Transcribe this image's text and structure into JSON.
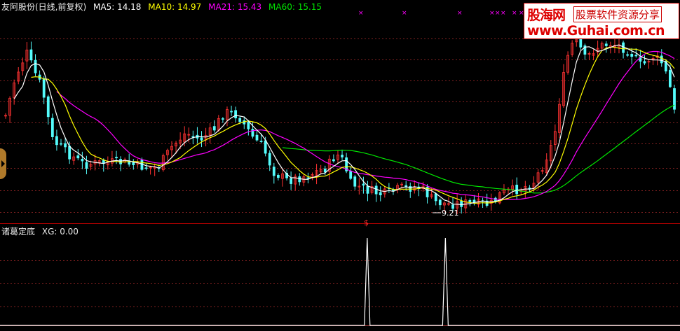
{
  "header": {
    "stock": "友阿股份(日线,前复权)",
    "ma5": "MA5: 14.18",
    "ma10": "MA10: 14.97",
    "ma21": "MA21: 15.43",
    "ma60": "MA60: 15.15"
  },
  "indicator": {
    "title": "诸葛定底",
    "value": "XG: 0.00",
    "signal_marker": "$"
  },
  "watermark": {
    "line1": "股海网",
    "line2": "股票软件资源分享",
    "line3": "www.Guhai.com.cn"
  },
  "colors": {
    "background": "#000000",
    "up": "#ff3232",
    "down": "#54fcfc",
    "ma5": "#ffffff",
    "ma10": "#ffff00",
    "ma21": "#ff00ff",
    "ma60": "#00e600",
    "grid": "#802020",
    "separator": "#b00000"
  },
  "chart_data": [
    {
      "type": "candlestick",
      "title": "友阿股份(日线,前复权)",
      "low_label": "9.21",
      "series": [
        {
          "name": "MA5",
          "value": 14.18
        },
        {
          "name": "MA10",
          "value": 14.97
        },
        {
          "name": "MA21",
          "value": 15.43
        },
        {
          "name": "MA60",
          "value": 15.15
        }
      ],
      "ylim": [
        8.5,
        22.5
      ],
      "grid": true
    },
    {
      "type": "line",
      "title": "诸葛定底",
      "series": [
        {
          "name": "XG",
          "value": 0.0,
          "spikes_at": [
            0.54,
            0.655
          ]
        }
      ],
      "ylim": [
        0,
        1
      ]
    }
  ]
}
